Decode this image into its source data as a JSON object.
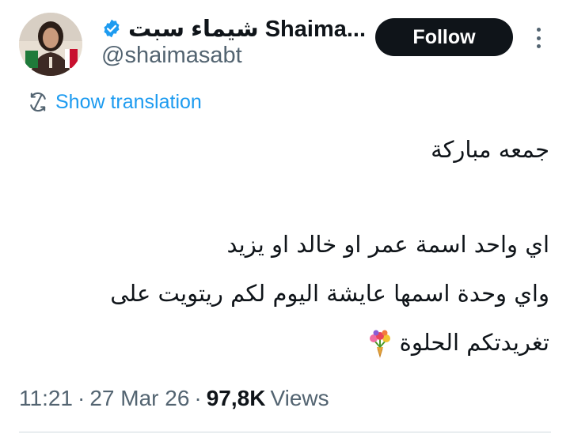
{
  "author": {
    "display_name": "شيماء سبت Shaima...",
    "handle": "@shaimasabt",
    "verified_icon": "verified-badge-icon"
  },
  "actions": {
    "follow_label": "Follow",
    "more_icon": "more-vertical-icon"
  },
  "translation": {
    "label": "Show translation",
    "icon": "translate-icon"
  },
  "tweet": {
    "lines": [
      "جمعه مباركة",
      "اي واحد اسمة عمر او خالد او يزيد",
      "واي وحدة اسمها عايشة اليوم لكم ريتويت على",
      "تغريدتكم الحلوة"
    ],
    "emoji": "bouquet-icon"
  },
  "meta": {
    "time": "11:21",
    "date": "27 Mar 26",
    "views_count": "97,8K",
    "views_label": "Views"
  },
  "colors": {
    "accent": "#1d9bf0",
    "follow_bg": "#0f1419",
    "muted_text": "#536471"
  }
}
